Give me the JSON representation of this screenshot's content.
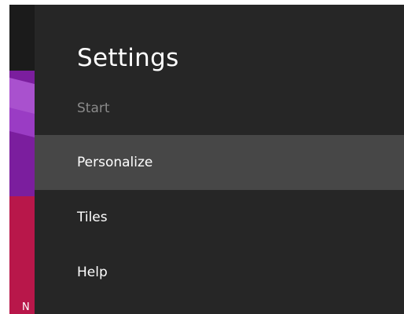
{
  "background_start_screen": {
    "tile_letter": "N",
    "tile_colors": [
      "#1b1b1b",
      "#7b1e9e",
      "#b8174a"
    ]
  },
  "settings_pane": {
    "title": "Settings",
    "context": "Start",
    "items": [
      {
        "label": "Personalize",
        "selected": true
      },
      {
        "label": "Tiles",
        "selected": false
      },
      {
        "label": "Help",
        "selected": false
      }
    ],
    "colors": {
      "pane_background": "#262626",
      "selected_background": "#474747",
      "text": "#ffffff",
      "subtle_text": "#8a8a8a"
    }
  }
}
